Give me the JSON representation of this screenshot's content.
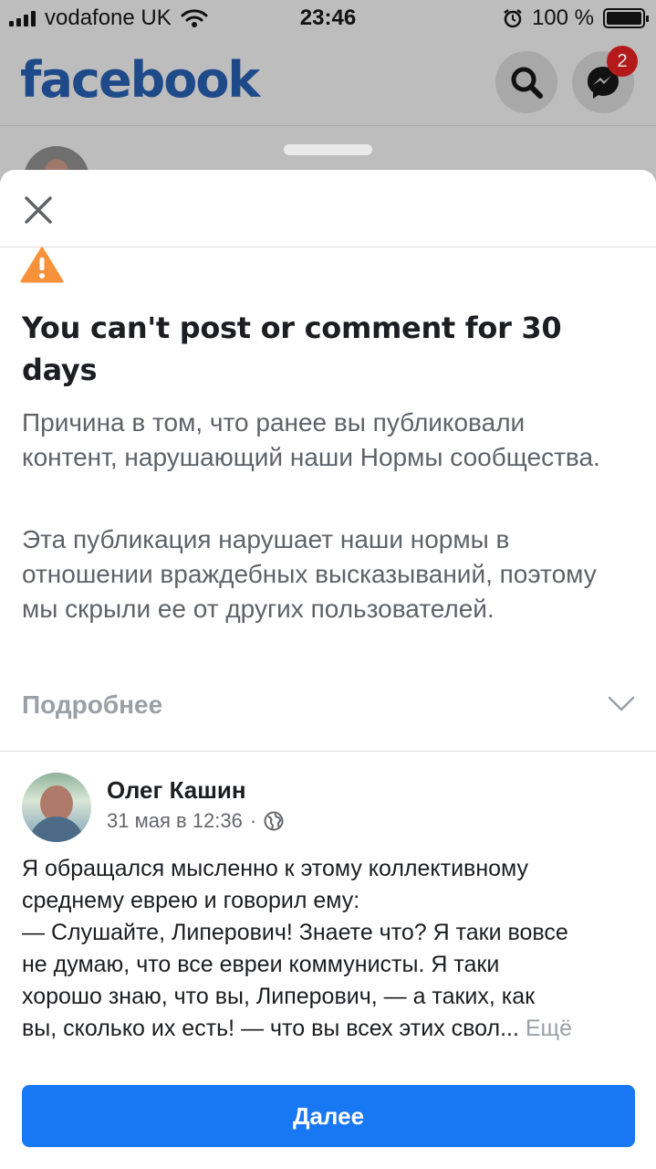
{
  "status_bar": {
    "carrier": "vodafone UK",
    "time": "23:46",
    "battery": "100 %",
    "icons": [
      "signal-icon",
      "wifi-icon",
      "alarm-icon",
      "battery-icon"
    ]
  },
  "header": {
    "logo": "facebook",
    "messenger_badge": "2",
    "icons": [
      "search-icon",
      "messenger-icon"
    ]
  },
  "sheet": {
    "title": "You can't post or comment for 30 days",
    "reason": "Причина в том, что ранее вы публиковали контент, нарушающий наши Нормы сообщества.",
    "detail": "Эта публикация нарушает наши нормы в отношении враждебных высказываний, поэтому мы скрыли ее от других пользователей.",
    "more_label": "Подробнее",
    "post": {
      "author": "Олег Кашин",
      "date": "31 мая в 12:36",
      "separator": "·",
      "text_lines": [
        "Я обращался мысленно к этому коллективному",
        "среднему еврею и говорил ему:",
        "— Слушайте, Липерович! Знаете что? Я таки вовсе",
        "не думаю, что все евреи коммунисты. Я таки",
        "хорошо знаю, что вы, Липерович, — а таких, как",
        "вы, сколько их есть! — что вы всех этих свол..."
      ],
      "see_more": "Ещё"
    },
    "next_button": "Далее"
  },
  "colors": {
    "brand_blue": "#1877f2",
    "warning_orange": "#f7923a",
    "badge_red": "#b51a1a",
    "dim_overlay": "#bdbdbd"
  }
}
